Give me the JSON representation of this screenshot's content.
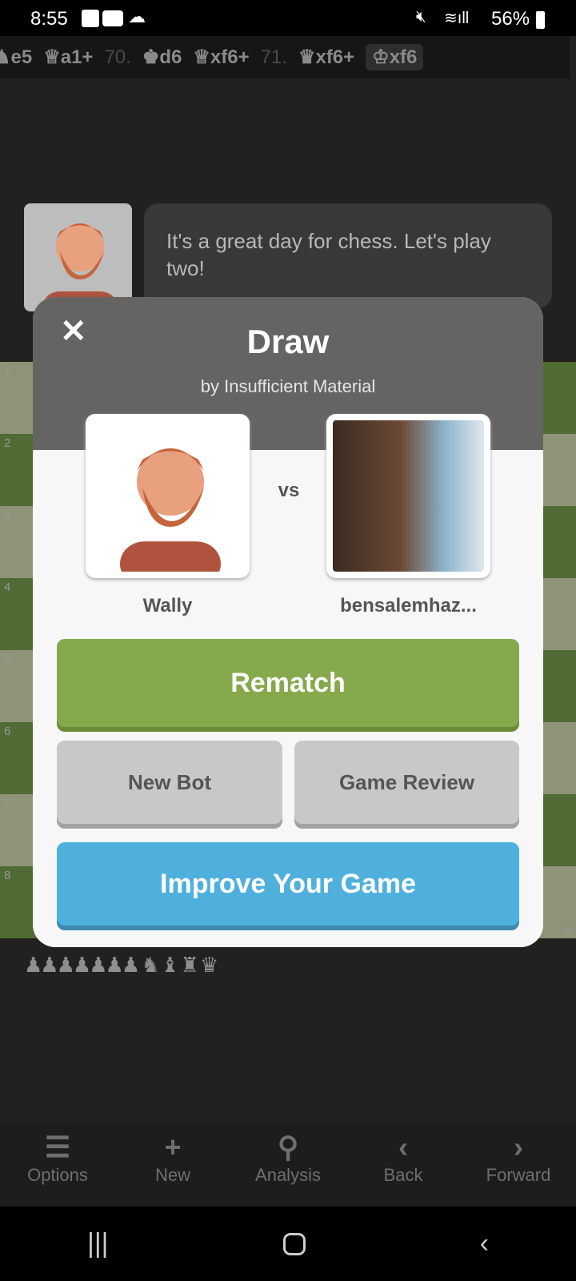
{
  "status": {
    "time": "8:55",
    "battery": "56%"
  },
  "moves": [
    {
      "t": "e5",
      "p": "♞"
    },
    {
      "t": "a1+",
      "p": "♕"
    },
    {
      "n": "70."
    },
    {
      "t": "d6",
      "p": "♚"
    },
    {
      "t": "xf6+",
      "p": "♕"
    },
    {
      "n": "71."
    },
    {
      "t": "xf6+",
      "p": "♛"
    },
    {
      "t": "xf6",
      "p": "♔",
      "current": true
    }
  ],
  "chat": {
    "message": "It's a great day for chess. Let's play two!"
  },
  "board": {
    "ranks": [
      "1",
      "2",
      "3",
      "4",
      "5",
      "6",
      "7",
      "8"
    ],
    "file": "a"
  },
  "captured": "♟♟♟♟♟♟♟ ♞ ♝ ♜ ♛",
  "modal": {
    "title": "Draw",
    "subtitle": "by Insufficient Material",
    "vs": "vs",
    "player1": "Wally",
    "player2": "bensalemhaz...",
    "rematch": "Rematch",
    "new_bot": "New Bot",
    "game_review": "Game Review",
    "improve": "Improve Your Game"
  },
  "nav": [
    {
      "label": "Options",
      "icon": "list-icon"
    },
    {
      "label": "New",
      "icon": "plus-icon"
    },
    {
      "label": "Analysis",
      "icon": "magnifier-icon"
    },
    {
      "label": "Back",
      "icon": "chevron-left-icon"
    },
    {
      "label": "Forward",
      "icon": "chevron-right-icon"
    }
  ],
  "colors": {
    "rematch": "#86a94c",
    "improve": "#4fb0dd",
    "secondary": "#c8c8c8"
  }
}
